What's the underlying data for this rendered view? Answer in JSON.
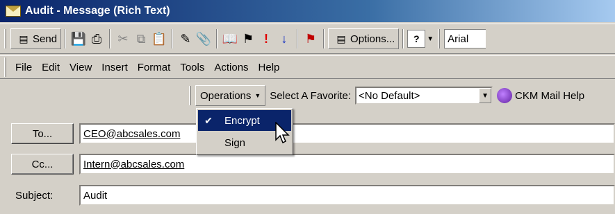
{
  "window": {
    "title": "Audit - Message (Rich Text)"
  },
  "toolbar": {
    "send_label": "Send",
    "options_label": "Options...",
    "font": "Arial",
    "icons": [
      "save-icon",
      "print-icon",
      "cut-icon",
      "copy-icon",
      "paste-icon",
      "check-names-icon",
      "attach-icon",
      "address-book-icon",
      "flag-icon",
      "high-importance-icon",
      "low-importance-icon",
      "follow-up-flag-icon",
      "options-icon",
      "help-icon"
    ]
  },
  "menubar": {
    "items": [
      "File",
      "Edit",
      "View",
      "Insert",
      "Format",
      "Tools",
      "Actions",
      "Help"
    ]
  },
  "ckm_toolbar": {
    "operations_label": "Operations",
    "favorite_label": "Select A Favorite:",
    "favorite_value": "<No Default>",
    "help_label": "CKM Mail Help"
  },
  "operations_menu": {
    "items": [
      {
        "label": "Encrypt",
        "checked": true,
        "selected": true
      },
      {
        "label": "Sign",
        "checked": false,
        "selected": false
      }
    ]
  },
  "message": {
    "to_button": "To...",
    "to_value": "CEO@abcsales.com",
    "cc_button": "Cc...",
    "cc_value": "Intern@abcsales.com",
    "subject_label": "Subject:",
    "subject_value": "Audit"
  },
  "colors": {
    "title_bar": "#0a246a",
    "menu_highlight": "#0a246a",
    "face": "#d4d0c8"
  }
}
